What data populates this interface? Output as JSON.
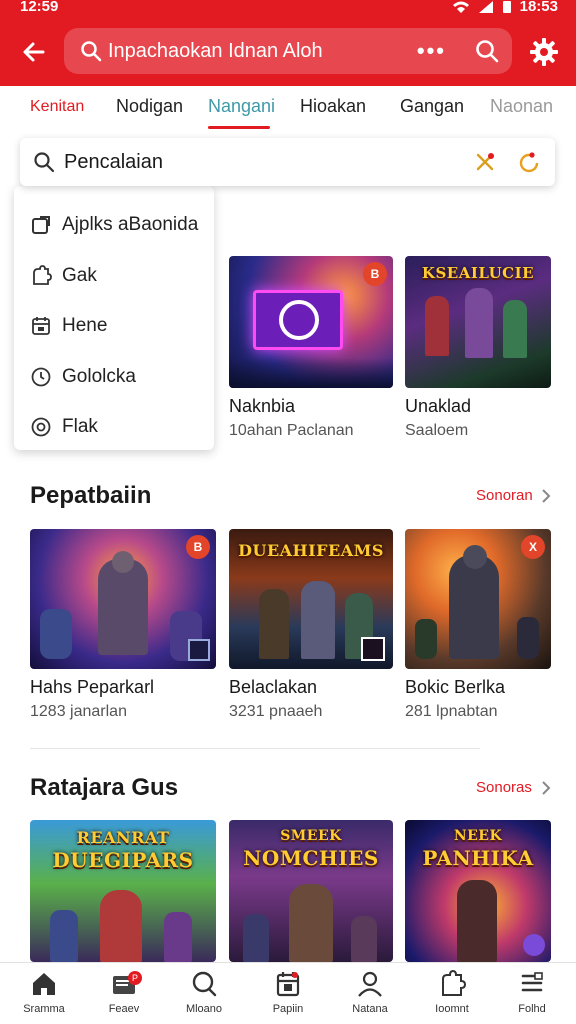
{
  "status_bar": {
    "time": "12:59",
    "right_time": "18:53"
  },
  "app_bar": {
    "search_text": "Inpachaokan Idnan Aloh",
    "dots": "•••"
  },
  "tabs": [
    {
      "label": "Kenitan"
    },
    {
      "label": "Nodigan"
    },
    {
      "label": "Nangani"
    },
    {
      "label": "Hioakan"
    },
    {
      "label": "Gangan"
    },
    {
      "label": "Naonan"
    }
  ],
  "search_overlay": {
    "value": "Pencalaian"
  },
  "dropdown_menu": [
    {
      "label": "Ajplks aBaonida",
      "icon": "app-icon"
    },
    {
      "label": "Gak",
      "icon": "puzzle-icon"
    },
    {
      "label": "Hene",
      "icon": "calendar-icon"
    },
    {
      "label": "Gololcka",
      "icon": "clock-icon"
    },
    {
      "label": "Flak",
      "icon": "target-icon"
    }
  ],
  "top_row": [
    {
      "title": "Naknbia",
      "sub": "10ahan Paclanan",
      "badge": "B"
    },
    {
      "title": "Unaklad",
      "sub": "Saaloem",
      "thumb_text": "KSEAILUCIE"
    }
  ],
  "section1": {
    "title": "Pepatbaiin",
    "link": "Sonoran",
    "cards": [
      {
        "title": "Hahs Peparkarl",
        "sub": "1283 janarlan",
        "badge": "B"
      },
      {
        "title": "Belaclakan",
        "sub": "3231 pnaaeh",
        "thumb_text": "DUEAHIFEAMS"
      },
      {
        "title": "Bokic Berlka",
        "sub": "281 lpnabtan",
        "badge": "X"
      }
    ]
  },
  "section2": {
    "title": "Ratajara Gus",
    "link": "Sonoras",
    "cards": [
      {
        "thumb_text_top": "REANRAT",
        "thumb_text": "DUEGIPARS"
      },
      {
        "thumb_text_top": "SMEEK",
        "thumb_text": "NOMCHIES"
      },
      {
        "thumb_text_top": "NEEK",
        "thumb_text": "PANHIKA"
      }
    ]
  },
  "bottom_nav": [
    {
      "label": "Sramma",
      "icon": "home-icon"
    },
    {
      "label": "Feaev",
      "icon": "inbox-icon",
      "badge": "P"
    },
    {
      "label": "Mloano",
      "icon": "search-icon"
    },
    {
      "label": "Papiin",
      "icon": "calendar-icon"
    },
    {
      "label": "Natana",
      "icon": "person-icon"
    },
    {
      "label": "Ioomnt",
      "icon": "puzzle-icon"
    },
    {
      "label": "Folhd",
      "icon": "list-icon"
    }
  ],
  "colors": {
    "brand": "#e21b23",
    "active_tab": "#3e9aa8",
    "accent_underline": "#e21b23"
  }
}
